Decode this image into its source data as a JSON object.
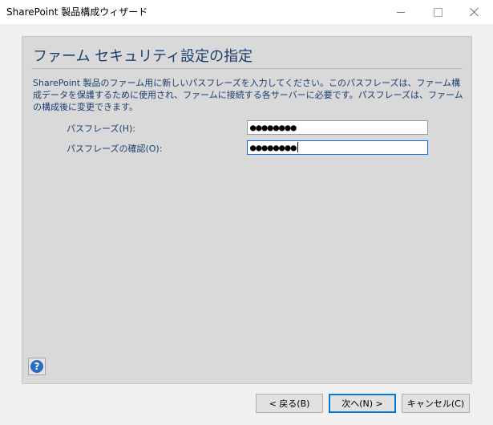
{
  "window": {
    "title": "SharePoint 製品構成ウィザード"
  },
  "page": {
    "heading": "ファーム セキュリティ設定の指定",
    "description": "SharePoint 製品のファーム用に新しいパスフレーズを入力してください。このパスフレーズは、ファーム構成データを保護するために使用され、ファームに接続する各サーバーに必要です。パスフレーズは、ファームの構成後に変更できます。"
  },
  "form": {
    "passphrase_label": "パスフレーズ(H):",
    "passphrase_value": "●●●●●●●●",
    "confirm_label": "パスフレーズの確認(O):",
    "confirm_value": "●●●●●●●●"
  },
  "icons": {
    "help": "help-icon",
    "minimize": "minimize-icon",
    "maximize": "maximize-icon",
    "close": "close-icon"
  },
  "help_glyph": "?",
  "buttons": {
    "back": "< 戻る(B)",
    "next": "次へ(N) >",
    "cancel": "キャンセル(C)"
  },
  "colors": {
    "heading_text": "#1a3e6e",
    "panel_bg": "#d9d9d9",
    "focus_border": "#0078d7",
    "help_icon_bg": "#2a6bc6"
  }
}
